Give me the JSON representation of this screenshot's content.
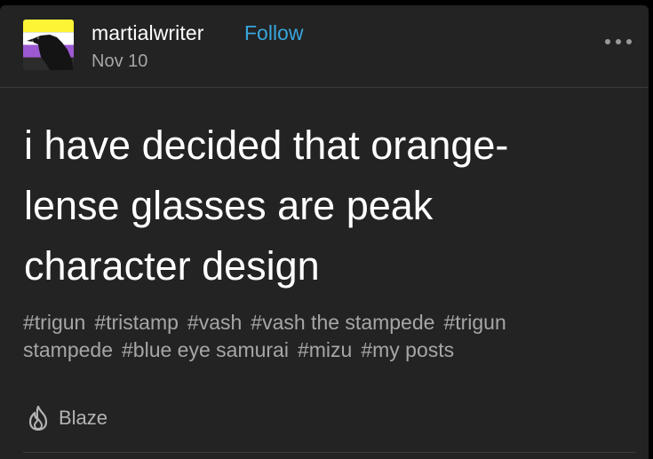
{
  "post": {
    "author": {
      "username": "martialwriter",
      "follow_label": "Follow",
      "date": "Nov 10"
    },
    "more_icon": "ellipsis-icon",
    "body_lines": [
      "i have decided that orange-",
      "lense glasses are peak",
      "character design"
    ],
    "tag_lines": [
      [
        "#trigun",
        "#tristamp",
        "#vash",
        "#vash the stampede",
        "#trigun"
      ],
      [
        "stampede",
        "#blue eye samurai",
        "#mizu",
        "#my posts"
      ]
    ],
    "blaze_label": "Blaze",
    "blaze_icon": "flame-icon"
  },
  "colors": {
    "background": "#232323",
    "text": "#ffffff",
    "muted": "#a6a6a6",
    "accent": "#37a6dc"
  }
}
